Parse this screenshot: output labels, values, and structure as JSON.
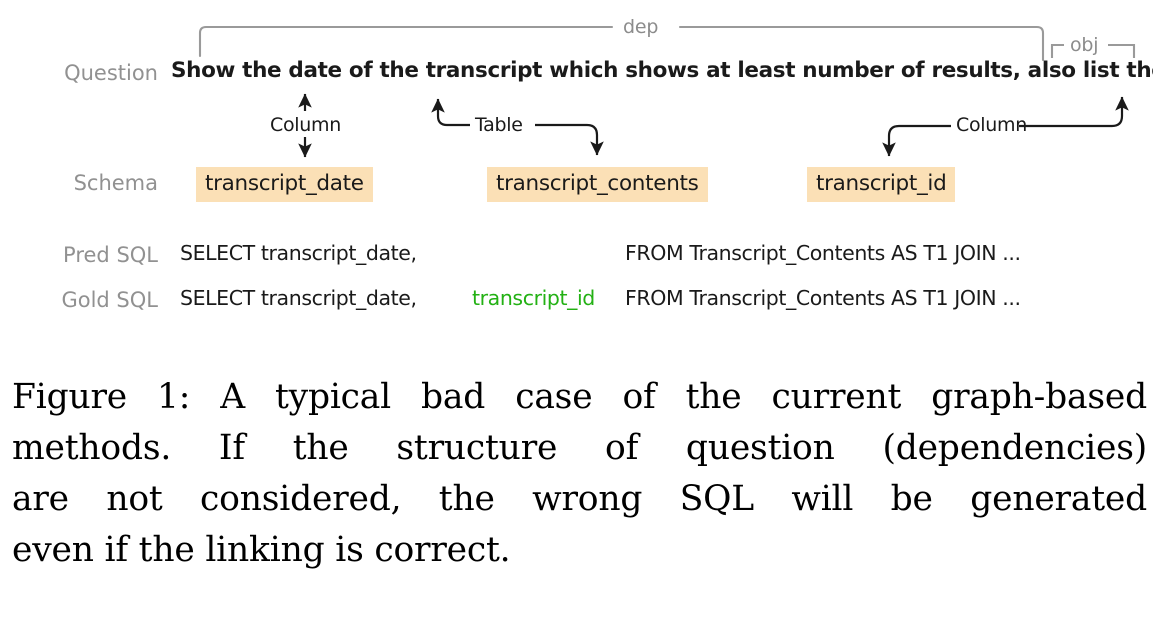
{
  "figure": {
    "row_labels": {
      "question": "Question",
      "schema": "Schema",
      "pred_sql": "Pred SQL",
      "gold_sql": "Gold SQL"
    },
    "question_text": "Show the date of the transcript which shows at least number of results, also list the id.",
    "schema_items": [
      {
        "label": "transcript_date"
      },
      {
        "label": "transcript_contents"
      },
      {
        "label": "transcript_id"
      }
    ],
    "dependency_brackets": [
      {
        "label": "dep"
      },
      {
        "label": "obj"
      }
    ],
    "linking_edges": [
      {
        "label": "Column"
      },
      {
        "label": "Table"
      },
      {
        "label": "Column"
      }
    ],
    "pred_sql": {
      "select_part": "SELECT  transcript_date,",
      "missing_part": "",
      "from_part": "FROM  Transcript_Contents AS T1 JOIN ..."
    },
    "gold_sql": {
      "select_part": "SELECT  transcript_date,",
      "highlight_part": "transcript_id",
      "from_part": "FROM  Transcript_Contents AS T1 JOIN ..."
    },
    "colors": {
      "schema_highlight": "#fbe0b6",
      "gold_highlight_text": "#23b114",
      "row_label": "#919191",
      "bracket": "#8c8c8c",
      "body_text": "#1a1a1a"
    }
  },
  "caption": {
    "lines": [
      "Figure 1: A typical bad case of the current graph-based",
      "methods.   If the structure of question (dependencies)",
      "are not considered, the wrong SQL will be generated",
      "even if the linking is correct."
    ]
  }
}
